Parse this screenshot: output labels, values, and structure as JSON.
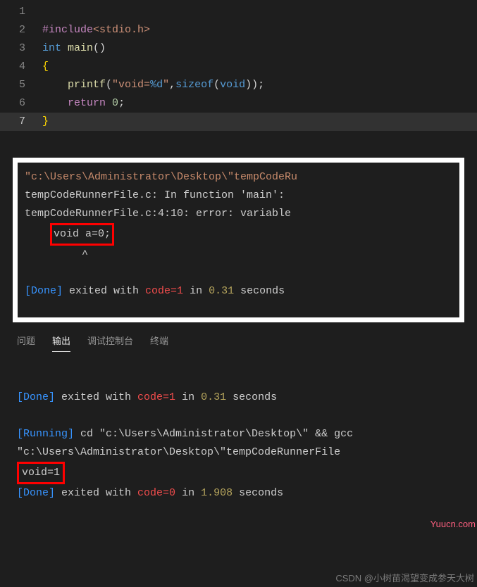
{
  "editor": {
    "lines": [
      {
        "num": "1",
        "tokens": []
      },
      {
        "num": "2",
        "tokens": [
          {
            "cls": "tok-directive",
            "t": "#include"
          },
          {
            "cls": "tok-string",
            "t": "<stdio.h>"
          }
        ]
      },
      {
        "num": "3",
        "tokens": [
          {
            "cls": "tok-keyword",
            "t": "int"
          },
          {
            "cls": "",
            "t": " "
          },
          {
            "cls": "tok-func",
            "t": "main"
          },
          {
            "cls": "tok-punct",
            "t": "()"
          }
        ]
      },
      {
        "num": "4",
        "tokens": [
          {
            "cls": "tok-brace",
            "t": "{"
          }
        ]
      },
      {
        "num": "5",
        "tokens": [
          {
            "cls": "",
            "t": "    "
          },
          {
            "cls": "tok-func",
            "t": "printf"
          },
          {
            "cls": "tok-punct",
            "t": "("
          },
          {
            "cls": "tok-string",
            "t": "\"void="
          },
          {
            "cls": "tok-format",
            "t": "%d"
          },
          {
            "cls": "tok-string",
            "t": "\""
          },
          {
            "cls": "tok-punct",
            "t": ","
          },
          {
            "cls": "tok-keyword",
            "t": "sizeof"
          },
          {
            "cls": "tok-punct",
            "t": "("
          },
          {
            "cls": "tok-keyword",
            "t": "void"
          },
          {
            "cls": "tok-punct",
            "t": "));"
          }
        ]
      },
      {
        "num": "6",
        "tokens": [
          {
            "cls": "",
            "t": "    "
          },
          {
            "cls": "tok-control",
            "t": "return"
          },
          {
            "cls": "",
            "t": " "
          },
          {
            "cls": "tok-number",
            "t": "0"
          },
          {
            "cls": "tok-punct",
            "t": ";"
          }
        ]
      },
      {
        "num": "7",
        "tokens": [
          {
            "cls": "tok-brace",
            "t": "}"
          }
        ],
        "active": true
      }
    ]
  },
  "error_box": {
    "path_line": "\"c:\\Users\\Administrator\\Desktop\\\"tempCodeRu",
    "line2": "tempCodeRunnerFile.c: In function 'main':",
    "line3": "tempCodeRunnerFile.c:4:10: error: variable ",
    "void_boxed": "void a=0;",
    "caret": "         ^",
    "done_label": "[Done]",
    "done_text": " exited with ",
    "code_label": "code=1",
    "done_text2": " in ",
    "time_label": "0.31",
    "done_text3": " seconds"
  },
  "tabs": {
    "problems": "问题",
    "output": "输出",
    "debug": "调试控制台",
    "terminal": "终端"
  },
  "output": {
    "done1": {
      "label": "[Done]",
      "t1": " exited with ",
      "code": "code=1",
      "t2": " in ",
      "time": "0.31",
      "t3": " seconds"
    },
    "running": {
      "label": "[Running]",
      "cmd": " cd \"c:\\Users\\Administrator\\Desktop\\\" && gcc"
    },
    "path2": "\"c:\\Users\\Administrator\\Desktop\\\"tempCodeRunnerFile",
    "result_boxed": "void=1",
    "done2": {
      "label": "[Done]",
      "t1": " exited with ",
      "code": "code=0",
      "t2": " in ",
      "time": "1.908",
      "t3": " seconds"
    }
  },
  "watermark": "CSDN @小树苗渴望变成参天大树",
  "watermark2": "Yuucn.com"
}
